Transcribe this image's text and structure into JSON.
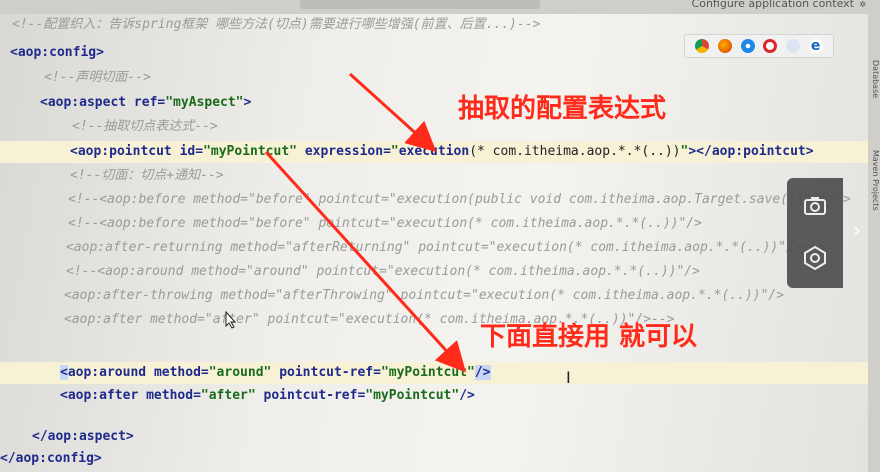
{
  "top": {
    "context_label": "Configure application context"
  },
  "browsers": [
    "chrome-icon",
    "firefox-icon",
    "safari-icon",
    "opera-icon",
    "ie-icon",
    "edge-icon"
  ],
  "code": {
    "l1": "<!--配置织入：告诉spring框架 哪些方法(切点)需要进行哪些增强(前置、后置...)-->",
    "l2_tag": "<aop:config>",
    "l3": "<!--声明切面-->",
    "l4_open": "<aop:aspect",
    "l4_attr": "ref=",
    "l4_val": "\"myAspect\"",
    "l4_close": ">",
    "l5": "<!--抽取切点表达式-->",
    "l6_open": "<aop:pointcut",
    "l6_attr1": "id=",
    "l6_val1": "\"myPointcut\"",
    "l6_attr2": "expression=",
    "l6_q1": "\"",
    "l6_exec": "execution",
    "l6_expr": "(* com.itheima.aop.*.*(..))",
    "l6_q2": "\"",
    "l6_close": "></aop:pointcut>",
    "l7": "<!--切面：切点+通知-->",
    "l8": "<!--<aop:before method=\"before\" pointcut=\"execution(public void com.itheima.aop.Target.save())\"/>-->",
    "l9": "<!--<aop:before method=\"before\" pointcut=\"execution(* com.itheima.aop.*.*(..))\"/>",
    "l10": "<aop:after-returning method=\"afterReturning\" pointcut=\"execution(* com.itheima.aop.*.*(..))\"/>-->",
    "l11": "<!--<aop:around method=\"around\" pointcut=\"execution(* com.itheima.aop.*.*(..))\"/>",
    "l12": "<aop:after-throwing method=\"afterThrowing\" pointcut=\"execution(* com.itheima.aop.*.*(..))\"/>",
    "l13": "<aop:after method=\"after\" pointcut=\"execution(* com.itheima.aop.*.*(..))\"/>-->",
    "l14_lt": "<",
    "l14_tag": "aop:around",
    "l14_attr1": "method=",
    "l14_val1": "\"around\"",
    "l14_attr2": "pointcut-ref=",
    "l14_val2": "\"myPointcut\"",
    "l14_close": "/>",
    "l15_open": "<aop:after",
    "l15_attr1": "method=",
    "l15_val1": "\"after\"",
    "l15_attr2": "pointcut-ref=",
    "l15_val2": "\"myPointcut\"",
    "l15_close": "/>",
    "l16": "</aop:aspect>",
    "l17": "</aop:config>"
  },
  "annotations": {
    "a1": "抽取的配置表达式",
    "a2": "下面直接用 就可以"
  },
  "right_tools": [
    "Database",
    "Maven Projects"
  ],
  "colors": {
    "annotation": "#ff2a1a",
    "tag": "#1f2a8c",
    "string": "#1a6b1a",
    "comment": "#9a9a9a"
  }
}
